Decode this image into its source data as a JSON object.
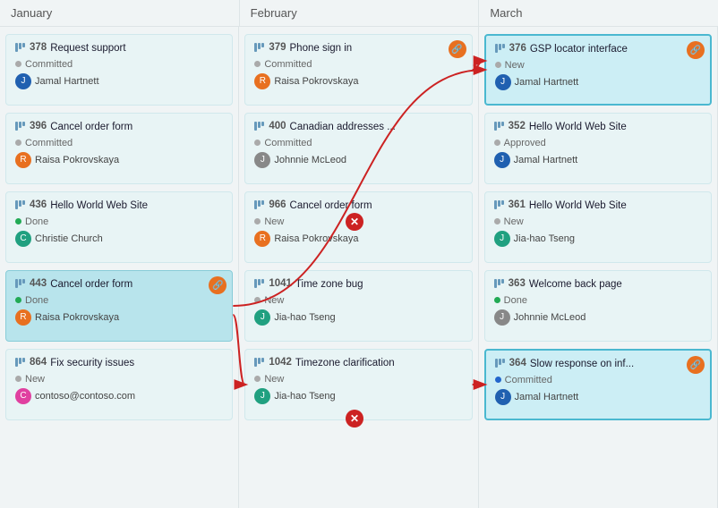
{
  "header": {
    "columns": [
      "January",
      "February",
      "March"
    ]
  },
  "cards": {
    "january": [
      {
        "id": "378",
        "title": "Request support",
        "status": "Committed",
        "statusType": "committed",
        "user": "Jamal Hartnett",
        "avatarColor": "blue",
        "linked": false,
        "highlighted": false
      },
      {
        "id": "396",
        "title": "Cancel order form",
        "status": "Committed",
        "statusType": "committed",
        "user": "Raisa Pokrovskaya",
        "avatarColor": "orange",
        "linked": false,
        "highlighted": false
      },
      {
        "id": "436",
        "title": "Hello World Web Site",
        "status": "Done",
        "statusType": "done",
        "user": "Christie Church",
        "avatarColor": "teal",
        "linked": false,
        "highlighted": false
      },
      {
        "id": "443",
        "title": "Cancel order form",
        "status": "Done",
        "statusType": "done",
        "user": "Raisa Pokrovskaya",
        "avatarColor": "orange",
        "linked": true,
        "highlighted": true
      },
      {
        "id": "864",
        "title": "Fix security issues",
        "status": "New",
        "statusType": "new",
        "user": "contoso@contoso.com",
        "avatarColor": "pink",
        "linked": false,
        "highlighted": false
      }
    ],
    "february": [
      {
        "id": "379",
        "title": "Phone sign in",
        "status": "Committed",
        "statusType": "committed",
        "user": "Raisa Pokrovskaya",
        "avatarColor": "orange",
        "linked": true,
        "highlighted": false
      },
      {
        "id": "400",
        "title": "Canadian addresses ...",
        "status": "Committed",
        "statusType": "committed",
        "user": "Johnnie McLeod",
        "avatarColor": "gray",
        "linked": false,
        "highlighted": false
      },
      {
        "id": "966",
        "title": "Cancel order form",
        "status": "New",
        "statusType": "new",
        "user": "Raisa Pokrovskaya",
        "avatarColor": "orange",
        "linked": false,
        "highlighted": false
      },
      {
        "id": "1041",
        "title": "Time zone bug",
        "status": "New",
        "statusType": "new",
        "user": "Jia-hao Tseng",
        "avatarColor": "teal",
        "linked": false,
        "highlighted": false
      },
      {
        "id": "1042",
        "title": "Timezone clarification",
        "status": "New",
        "statusType": "new",
        "user": "Jia-hao Tseng",
        "avatarColor": "teal",
        "linked": false,
        "highlighted": false
      }
    ],
    "march": [
      {
        "id": "376",
        "title": "GSP locator interface",
        "status": "New",
        "statusType": "new",
        "user": "Jamal Hartnett",
        "avatarColor": "blue",
        "linked": true,
        "highlighted": true,
        "selectedBlue": true
      },
      {
        "id": "352",
        "title": "Hello World Web Site",
        "status": "Approved",
        "statusType": "approved",
        "user": "Jamal Hartnett",
        "avatarColor": "blue",
        "linked": false,
        "highlighted": false
      },
      {
        "id": "361",
        "title": "Hello World Web Site",
        "status": "New",
        "statusType": "new",
        "user": "Jia-hao Tseng",
        "avatarColor": "teal",
        "linked": false,
        "highlighted": false
      },
      {
        "id": "363",
        "title": "Welcome back page",
        "status": "Done",
        "statusType": "done",
        "user": "Johnnie McLeod",
        "avatarColor": "gray",
        "linked": false,
        "highlighted": false
      },
      {
        "id": "364",
        "title": "Slow response on inf...",
        "status": "Committed",
        "statusType": "committed-blue",
        "user": "Jamal Hartnett",
        "avatarColor": "blue",
        "linked": true,
        "highlighted": true,
        "selectedBlue": true
      }
    ]
  },
  "statusColors": {
    "committed": "#aaaaaa",
    "done": "#22aa55",
    "new": "#aaaaaa",
    "approved": "#aaaaaa",
    "committed-blue": "#2266cc"
  }
}
